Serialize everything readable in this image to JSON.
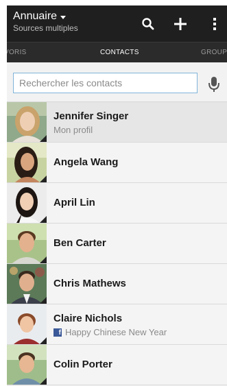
{
  "header": {
    "title": "Annuaire",
    "subtitle": "Sources multiples",
    "actions": {
      "search_icon": "search-icon",
      "add_icon": "plus-icon",
      "more_icon": "overflow-menu-icon"
    }
  },
  "tabs": [
    {
      "label": "VORIS",
      "active": false
    },
    {
      "label": "CONTACTS",
      "active": true
    },
    {
      "label": "GROUPE",
      "active": false
    }
  ],
  "search": {
    "placeholder": "Rechercher les contacts",
    "value": "",
    "mic_icon": "microphone-icon"
  },
  "contacts": [
    {
      "name": "Jennifer Singer",
      "subtitle": "Mon profil"
    },
    {
      "name": "Angela Wang"
    },
    {
      "name": "April Lin"
    },
    {
      "name": "Ben Carter"
    },
    {
      "name": "Chris Mathews"
    },
    {
      "name": "Claire Nichols",
      "subtitle": "Happy Chinese New Year",
      "subtitle_icon": "facebook-icon"
    },
    {
      "name": "Colin Porter"
    }
  ],
  "colors": {
    "header_bg": "#1f1f1f",
    "tabs_bg": "#2b2b2b",
    "search_border": "#7fb3d9",
    "facebook": "#3b5998"
  }
}
